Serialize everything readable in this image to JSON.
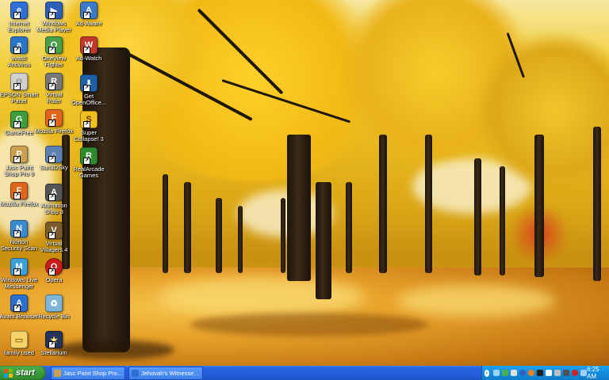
{
  "desktop": {
    "icons": [
      {
        "label": "Internet\nExplorer",
        "icon": "internet-explorer-icon",
        "color": "#2f6fd6",
        "glyph": "e"
      },
      {
        "label": "Windows\nMedia Player",
        "icon": "media-player-icon",
        "color": "#2b5fb8",
        "glyph": "▶"
      },
      {
        "label": "Ad-Aware",
        "icon": "ad-aware-icon",
        "color": "#3a7ac8",
        "glyph": "A"
      },
      {
        "label": "avast!\nAntivirus",
        "icon": "avast-icon",
        "color": "#2a74c9",
        "glyph": "a"
      },
      {
        "label": "OneView\nFighter",
        "icon": "oneview-icon",
        "color": "#4aa04a",
        "glyph": "O"
      },
      {
        "label": "Ad-Watch",
        "icon": "ad-watch-icon",
        "color": "#c0392b",
        "glyph": "W"
      },
      {
        "label": "EPSON Smart\nPanel",
        "icon": "epson-icon",
        "color": "#d0d0d0",
        "glyph": "☺"
      },
      {
        "label": "Virtual\nRuler",
        "icon": "virtual-ruler-icon",
        "color": "#777777",
        "glyph": "R"
      },
      {
        "label": "Get\nOpenOffice...",
        "icon": "openoffice-icon",
        "color": "#1e60a8",
        "glyph": "⬇"
      },
      {
        "label": "GameFree",
        "icon": "gamefree-icon",
        "color": "#3f9c3f",
        "glyph": "G"
      },
      {
        "label": "Mozilla Firefox",
        "icon": "firefox-icon",
        "color": "#e1661d",
        "glyph": "F"
      },
      {
        "label": "Super\nCollapse! 3",
        "icon": "super-collapse-icon",
        "color": "#f0c020",
        "glyph": "S"
      },
      {
        "label": "Jasc Paint\nShop Pro 9",
        "icon": "paint-shop-pro-icon",
        "color": "#c8a050",
        "glyph": "P"
      },
      {
        "label": "Sun3DSky",
        "icon": "sun-sky-icon",
        "color": "#5a7fb0",
        "glyph": "☼"
      },
      {
        "label": "RealArcade\nGames",
        "icon": "realarcade-icon",
        "color": "#2e8a2e",
        "glyph": "R"
      },
      {
        "label": "Mozilla Firefox",
        "icon": "firefox-icon",
        "color": "#e1661d",
        "glyph": "F"
      },
      {
        "label": "Animation\nShop 3",
        "icon": "animation-shop-icon",
        "color": "#555555",
        "glyph": "A"
      },
      {
        "label": "Norton\nSecurity Scan",
        "icon": "norton-icon",
        "color": "#3a8ad0",
        "glyph": "N"
      },
      {
        "label": "Virtual\nVillagers 4",
        "icon": "virtual-villagers-icon",
        "color": "#7a5a2a",
        "glyph": "V"
      },
      {
        "label": "Windows Live\nMessenger",
        "icon": "live-messenger-icon",
        "color": "#3aa0d8",
        "glyph": "M"
      },
      {
        "label": "Opera",
        "icon": "opera-icon",
        "color": "#cc1b1b",
        "glyph": "O"
      },
      {
        "label": "Avant Browser",
        "icon": "avant-browser-icon",
        "color": "#2d6fd0",
        "glyph": "A"
      },
      {
        "label": "Recycle Bin",
        "icon": "recycle-bin-icon",
        "color": "#7fb5d6",
        "glyph": "♻"
      },
      {
        "label": "family used",
        "icon": "folder-icon",
        "color": "#f3d36a",
        "glyph": "▭"
      },
      {
        "label": "Stellarium",
        "icon": "stellarium-icon",
        "color": "#26335a",
        "glyph": "★"
      }
    ]
  },
  "taskbar": {
    "start_label": "start",
    "tasks": [
      {
        "label": "Jasc Paint Shop Pro - ...",
        "icon": "paint-shop-pro-icon",
        "color": "#c8a050"
      },
      {
        "label": "Jehovah's Witnesses:...",
        "icon": "avant-browser-icon",
        "color": "#2d6fd0"
      }
    ],
    "tray_icons": [
      {
        "icon": "tray-network-icon",
        "color": "#9ad3f5"
      },
      {
        "icon": "tray-messenger-icon",
        "color": "#4caf50"
      },
      {
        "icon": "tray-shield-icon",
        "color": "#e0e0e0"
      },
      {
        "icon": "tray-globe-icon",
        "color": "#3060c0"
      },
      {
        "icon": "tray-avast-icon",
        "color": "#f08020"
      },
      {
        "icon": "tray-ad-icon",
        "color": "#222222"
      },
      {
        "icon": "tray-m-icon",
        "color": "#ffffff"
      },
      {
        "icon": "tray-gear-icon",
        "color": "#c0c0c0"
      },
      {
        "icon": "tray-monitor-icon",
        "color": "#505050"
      },
      {
        "icon": "tray-alert-icon",
        "color": "#d02020"
      },
      {
        "icon": "tray-volume-icon",
        "color": "#a0d0ff"
      }
    ],
    "clock": "6:25 AM"
  }
}
